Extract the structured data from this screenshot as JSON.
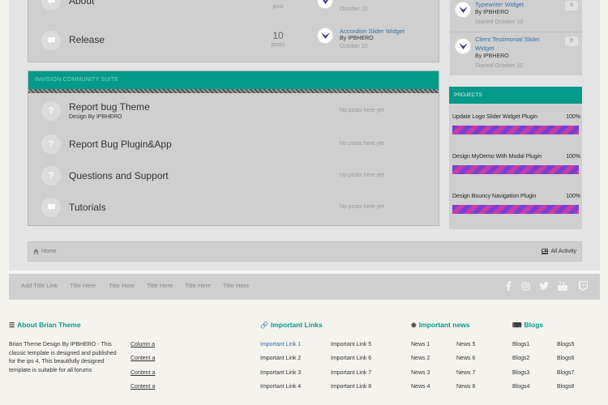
{
  "forum_top": {
    "partial_row": {
      "title": "About",
      "count_label": "post",
      "last_date": "October 10"
    },
    "release_row": {
      "title": "Release",
      "count": "10",
      "count_label": "posts",
      "last_title": "Accordion Slider Widget",
      "last_by": "By IPBHERO",
      "last_date": "October 10"
    }
  },
  "ics": {
    "header": "INVISION COMMUNITY SUITE",
    "rows": [
      {
        "title": "Report bug Theme",
        "sub": "Design By IPBHERO",
        "status": "No posts here yet"
      },
      {
        "title": "Report Bug Plugin&App",
        "sub": "",
        "status": "No posts here yet"
      },
      {
        "title": "Questions and Support",
        "sub": "",
        "status": "No posts here yet"
      },
      {
        "title": "Tutorials",
        "sub": "",
        "status": "No posts here yet"
      }
    ]
  },
  "sidebar_topics": [
    {
      "title": "Typewriter Widget",
      "by": "By IPBHERO",
      "date": "Started October 10",
      "count": "0"
    },
    {
      "title": "Client Testimonial Slider Widget",
      "by": "By IPBHERO",
      "date": "Started October 10",
      "count": "0"
    }
  ],
  "projects": {
    "header": "PROJECTS",
    "items": [
      {
        "name": "Update Logo Slider Widget Plugin",
        "pct_label": "100%",
        "progress": 100
      },
      {
        "name": "Design MyDemo With Modal Plugin",
        "pct_label": "100%",
        "progress": 100
      },
      {
        "name": "Design Bouncy Navigation Plugin",
        "pct_label": "100%",
        "progress": 100
      }
    ]
  },
  "breadcrumb": {
    "home": "Home",
    "activity": "All Activity"
  },
  "footer_nav": [
    "Add Title Link",
    "Title Here",
    "Title Here",
    "Title Here",
    "Title Here",
    "Title Here"
  ],
  "social_icons": [
    "facebook-icon",
    "instagram-icon",
    "twitter-icon",
    "youtube-icon",
    "twitch-icon"
  ],
  "footer": {
    "about": {
      "heading": "About Brian Theme",
      "text": "Brian Theme Design By IPBHERO - This classic template is designed and published for the ips 4, This beautifully designed template is suitable for all forums",
      "links": [
        "Column a",
        "Content a",
        "Content a",
        "Content a"
      ]
    },
    "important_links": {
      "heading": "Important Links",
      "col1": [
        "Important Link 1",
        "Important Link 2",
        "Important Link 3",
        "Important Link 4"
      ],
      "col2": [
        "Important Link 5",
        "Important Link 6",
        "Important Link 7",
        "Important Link 8"
      ]
    },
    "important_news": {
      "heading": "Important news",
      "col1": [
        "News 1",
        "News 2",
        "News 3",
        "News 4"
      ],
      "col2": [
        "News 5",
        "News 6",
        "News 7",
        "News 8"
      ]
    },
    "blogs": {
      "heading": "Blogs",
      "col1": [
        "Blogs1",
        "Blogs2",
        "Blogs3",
        "Blogs4"
      ],
      "col2": [
        "Blogs5",
        "Blogs6",
        "Blogs7",
        "Blogs8"
      ]
    }
  },
  "colors": {
    "accent": "#069a8a",
    "link": "#3c6e9f",
    "progress_a": "#7b3fd0",
    "progress_b": "#c23fa8"
  }
}
